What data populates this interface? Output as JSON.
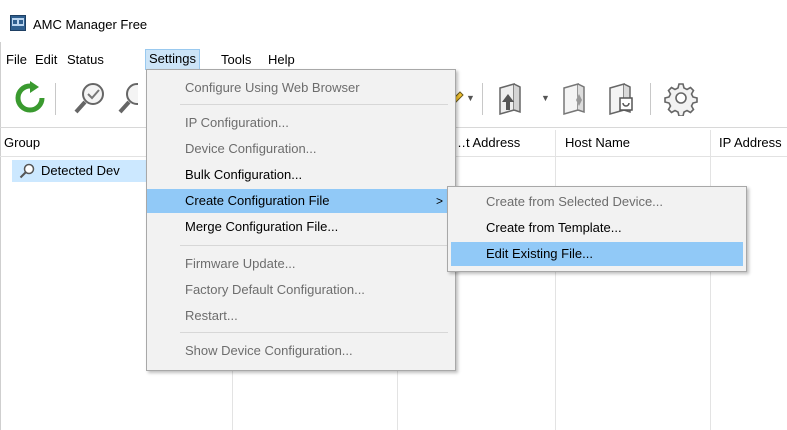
{
  "window": {
    "title": "AMC Manager Free"
  },
  "menubar": {
    "items": [
      {
        "label": "File",
        "active": false
      },
      {
        "label": "Edit",
        "active": false
      },
      {
        "label": "Status",
        "active": false
      },
      {
        "label": "Settings",
        "active": true
      },
      {
        "label": "Tools",
        "active": false
      },
      {
        "label": "Help",
        "active": false
      }
    ]
  },
  "toolbar": {
    "icons": [
      "refresh-icon",
      "search-device-icon",
      "search-device-icon",
      "pencil-dropdown-icon",
      "upload-config-icon",
      "config-file-icon",
      "firmware-file-icon",
      "gear-icon"
    ]
  },
  "table": {
    "group_header": "Group",
    "columns": [
      "…t Address",
      "Host Name",
      "IP Address"
    ],
    "tree": [
      {
        "label": "Detected Dev",
        "icon": "search-icon"
      }
    ]
  },
  "settings_menu": {
    "items": [
      {
        "label": "Configure Using Web Browser",
        "enabled": false
      },
      {
        "label": "IP Configuration...",
        "enabled": false
      },
      {
        "label": "Device Configuration...",
        "enabled": false
      },
      {
        "label": "Bulk Configuration...",
        "enabled": true
      },
      {
        "label": "Create Configuration File",
        "enabled": true,
        "highlighted": true,
        "submenu_arrow": ">"
      },
      {
        "label": "Merge Configuration File...",
        "enabled": true
      },
      {
        "label": "Firmware Update...",
        "enabled": false
      },
      {
        "label": "Factory Default Configuration...",
        "enabled": false
      },
      {
        "label": "Restart...",
        "enabled": false
      },
      {
        "label": "Show Device Configuration...",
        "enabled": false
      }
    ]
  },
  "create_submenu": {
    "items": [
      {
        "label": "Create from Selected Device...",
        "enabled": false
      },
      {
        "label": "Create from Template...",
        "enabled": true
      },
      {
        "label": "Edit Existing File...",
        "enabled": true,
        "highlighted": true
      }
    ]
  },
  "colors": {
    "highlight": "#91c9f7",
    "selection": "#cce8ff",
    "menu_bg": "#f2f2f2",
    "disabled_text": "#6d6d6d"
  }
}
